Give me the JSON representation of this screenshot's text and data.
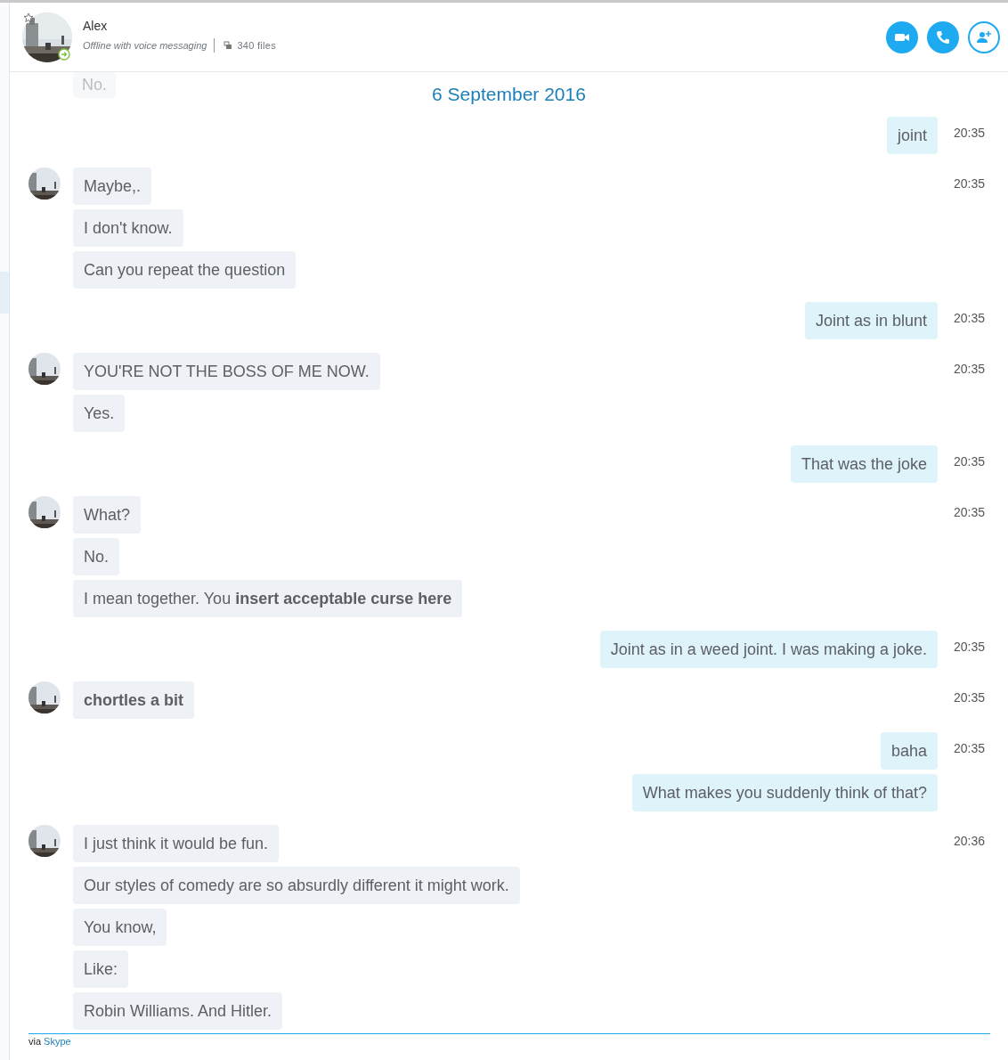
{
  "contact": {
    "name": "Alex",
    "status": "Offline with voice messaging",
    "files": "340 files"
  },
  "faded_message": "No.",
  "date": "6 September 2016",
  "groups": [
    {
      "kind": "outgoing",
      "time": "20:35",
      "messages": [
        {
          "text": "joint"
        }
      ]
    },
    {
      "kind": "incoming",
      "time": "20:35",
      "messages": [
        {
          "text": "Maybe,."
        },
        {
          "text": "I don't know."
        },
        {
          "text": "Can you repeat the question"
        }
      ]
    },
    {
      "kind": "outgoing",
      "time": "20:35",
      "messages": [
        {
          "text": "Joint as in blunt"
        }
      ]
    },
    {
      "kind": "incoming",
      "time": "20:35",
      "messages": [
        {
          "text": "YOU'RE NOT THE BOSS OF ME NOW."
        },
        {
          "text": "Yes."
        }
      ]
    },
    {
      "kind": "outgoing",
      "time": "20:35",
      "messages": [
        {
          "text": "That was the joke"
        }
      ]
    },
    {
      "kind": "incoming",
      "time": "20:35",
      "messages": [
        {
          "text": "What?"
        },
        {
          "text": "No."
        },
        {
          "text": "I mean together. You **insert acceptable curse here**"
        }
      ]
    },
    {
      "kind": "outgoing",
      "time": "20:35",
      "messages": [
        {
          "text": "Joint as in a weed joint. I was making a joke."
        }
      ]
    },
    {
      "kind": "incoming",
      "time": "20:35",
      "messages": [
        {
          "text": "chortles a bit",
          "bold": true
        }
      ]
    },
    {
      "kind": "outgoing",
      "time": "20:35",
      "messages": [
        {
          "text": "baha"
        },
        {
          "text": "What makes you suddenly think of that?"
        }
      ]
    },
    {
      "kind": "incoming",
      "time": "20:36",
      "messages": [
        {
          "text": "I just think it would be fun."
        },
        {
          "text": "Our styles of comedy are so absurdly different it might work."
        },
        {
          "text": "You know,"
        },
        {
          "text": "Like:"
        },
        {
          "text": "Robin Williams. And Hitler."
        }
      ]
    }
  ],
  "footer": {
    "prefix": "via",
    "link": "Skype"
  }
}
